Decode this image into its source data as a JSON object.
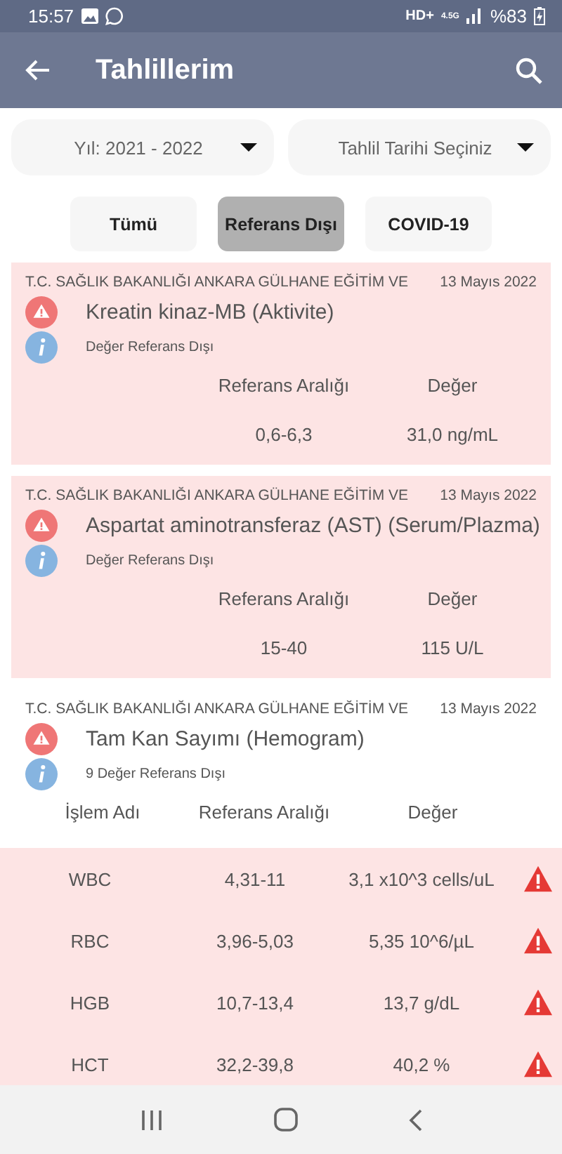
{
  "status_bar": {
    "time": "15:57",
    "network": "HD+",
    "data_type": "4.5G",
    "battery": "%83"
  },
  "app_bar": {
    "title": "Tahlillerim"
  },
  "dropdowns": [
    {
      "value": "Yıl: 2021 - 2022"
    },
    {
      "value": "Tahlil Tarihi Seçiniz"
    }
  ],
  "filters": [
    {
      "label": "Tümü",
      "selected": false
    },
    {
      "label": "Referans Dışı",
      "selected": true
    },
    {
      "label": "COVID-19",
      "selected": false
    }
  ],
  "results": [
    {
      "kind": "single",
      "institution": "T.C. SAĞLIK BAKANLIĞI ANKARA GÜLHANE EĞİTİM VE",
      "date": "13 Mayıs 2022",
      "title": "Kreatin kinaz-MB (Aktivite)",
      "note": "Değer Referans Dışı",
      "range_label": "Referans Aralığı",
      "value_label": "Değer",
      "range": "0,6-6,3",
      "value": "31,0 ng/mL"
    },
    {
      "kind": "single",
      "institution": "T.C. SAĞLIK BAKANLIĞI ANKARA GÜLHANE EĞİTİM VE",
      "date": "13 Mayıs 2022",
      "title": "Aspartat aminotransferaz (AST) (Serum/Plazma)",
      "note": "Değer Referans Dışı",
      "range_label": "Referans Aralığı",
      "value_label": "Değer",
      "range": "15-40",
      "value": "115 U/L"
    },
    {
      "kind": "panel",
      "institution": "T.C. SAĞLIK BAKANLIĞI ANKARA GÜLHANE EĞİTİM VE",
      "date": "13 Mayıs 2022",
      "title": "Tam Kan Sayımı (Hemogram)",
      "note": "9 Değer Referans Dışı",
      "name_label": "İşlem Adı",
      "range_label": "Referans Aralığı",
      "value_label": "Değer",
      "rows": [
        {
          "name": "WBC",
          "range": "4,31-11",
          "value": "3,1 x10^3 cells/uL",
          "alert": true
        },
        {
          "name": "RBC",
          "range": "3,96-5,03",
          "value": "5,35 10^6/µL",
          "alert": true
        },
        {
          "name": "HGB",
          "range": "10,7-13,4",
          "value": "13,7 g/dL",
          "alert": true
        },
        {
          "name": "HCT",
          "range": "32,2-39,8",
          "value": "40,2 %",
          "alert": true
        }
      ]
    }
  ]
}
